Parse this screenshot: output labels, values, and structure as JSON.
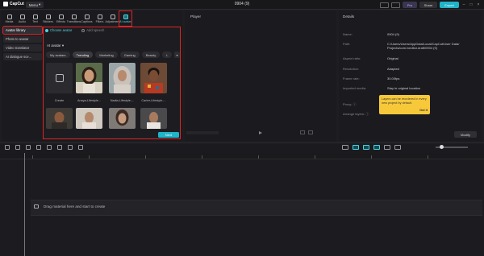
{
  "app": {
    "name": "CapCut",
    "menu_label": "Menu",
    "project_title": "0904 (9)"
  },
  "topbar": {
    "pro_label": "Pro",
    "share_label": "Share",
    "export_label": "Export"
  },
  "toolbar": {
    "items": [
      {
        "label": "Media",
        "icon": "media-icon"
      },
      {
        "label": "Audio",
        "icon": "audio-icon"
      },
      {
        "label": "Text",
        "icon": "text-icon"
      },
      {
        "label": "Stickers",
        "icon": "stickers-icon"
      },
      {
        "label": "Effects",
        "icon": "effects-icon"
      },
      {
        "label": "Transitions",
        "icon": "transitions-icon"
      },
      {
        "label": "Captions",
        "icon": "captions-icon"
      },
      {
        "label": "Filters",
        "icon": "filters-icon"
      },
      {
        "label": "Adjustment",
        "icon": "adjustment-icon"
      },
      {
        "label": "AI avatar",
        "icon": "ai-avatar-icon",
        "active": true
      }
    ]
  },
  "sidebar": {
    "items": [
      {
        "label": "Avatar library",
        "active": true
      },
      {
        "label": "Photo to avatar"
      },
      {
        "label": "Video translator"
      },
      {
        "label": "AI dialogue sce..."
      }
    ]
  },
  "avatar_panel": {
    "radio_choose": "Choose avatar",
    "radio_add_speech": "Add speech",
    "section_label": "AI avatar",
    "chips": [
      "My avatars",
      "Trending",
      "Marketing",
      "Gaming",
      "Beauty",
      "L"
    ],
    "chip_more": "▾",
    "cards": [
      {
        "label": "Create"
      },
      {
        "label": "Anaya-Lifestyle..."
      },
      {
        "label": "Nadia-Lifestyle-..."
      },
      {
        "label": "Carter-Lifestyle-..."
      }
    ],
    "next_label": "Next"
  },
  "player": {
    "title": "Player"
  },
  "details": {
    "title": "Details",
    "rows": [
      {
        "label": "Name:",
        "value": "0904 (9)"
      },
      {
        "label": "Path:",
        "value": "C:/Users/Users/AppData/Local/CapCut/User Data/ Projects/com.lveditor.draft/0904 (9)"
      },
      {
        "label": "Aspect ratio:",
        "value": "Original"
      },
      {
        "label": "Resolution:",
        "value": "Adapted"
      },
      {
        "label": "Frame rate:",
        "value": "30.00fps"
      },
      {
        "label": "Imported media:",
        "value": "Stay in original location"
      },
      {
        "label": "Proxy:",
        "value": ""
      },
      {
        "label": "Arrange layers:",
        "value": ""
      }
    ],
    "tooltip_text": "Layers can be reordered in every new project by default.",
    "tooltip_action": "Got it",
    "modify_label": "Modify"
  },
  "timeline": {
    "drop_hint": "Drag material here and start to create"
  },
  "colors": {
    "accent": "#1fb4c8",
    "highlight": "#e02424",
    "tooltip": "#f7c93a"
  }
}
